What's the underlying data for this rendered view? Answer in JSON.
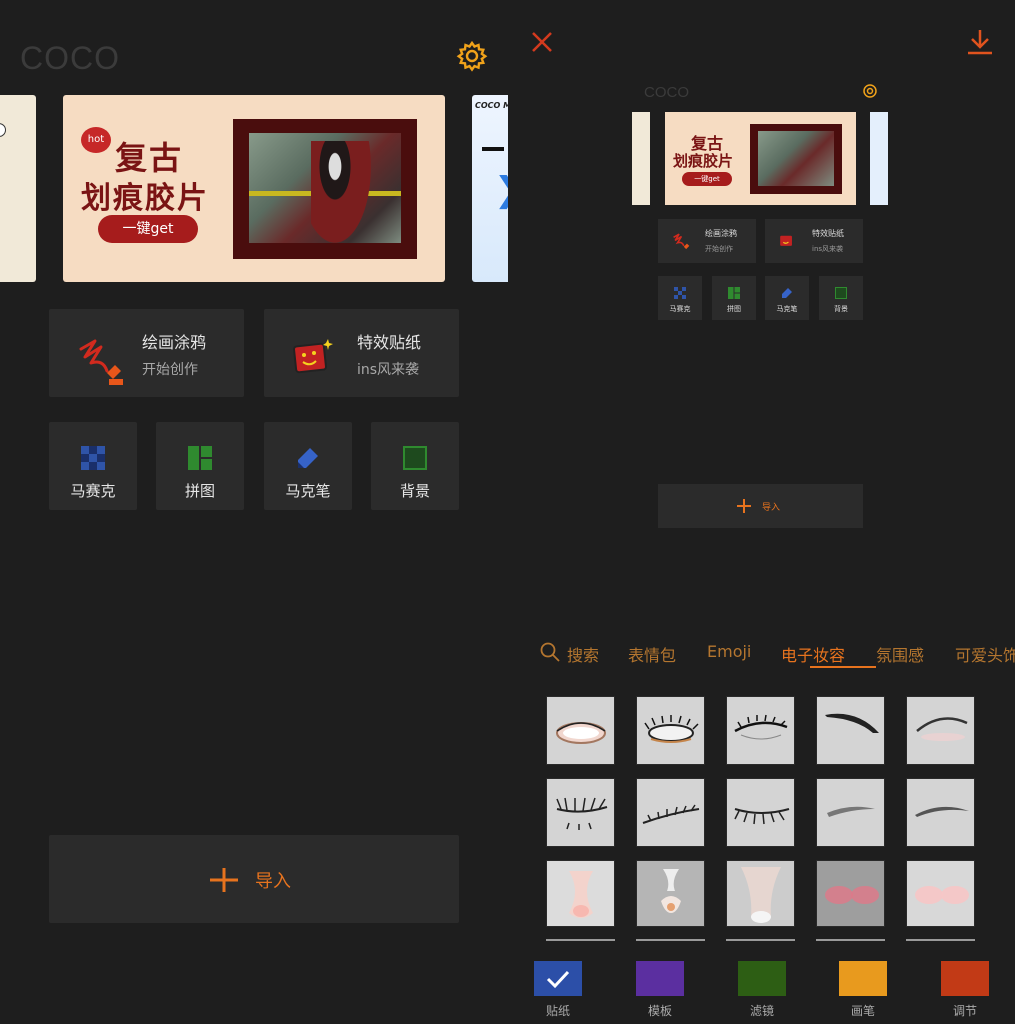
{
  "left": {
    "app_title": "COCO",
    "banner": {
      "hot": "hot",
      "title_line1": "复古",
      "title_line2": "划痕胶片",
      "cta": "一键get",
      "next_tag": "COCO MA"
    },
    "features": [
      {
        "title": "绘画涂鸦",
        "subtitle": "开始创作",
        "icon": "brush-scribble-icon"
      },
      {
        "title": "特效贴纸",
        "subtitle": "ins风来袭",
        "icon": "sticker-face-icon"
      }
    ],
    "tools": [
      {
        "label": "马赛克",
        "icon": "mosaic-icon",
        "color": "#2f54a8"
      },
      {
        "label": "拼图",
        "icon": "collage-icon",
        "color": "#2f8a2f"
      },
      {
        "label": "马克笔",
        "icon": "marker-icon",
        "color": "#3663c8"
      },
      {
        "label": "背景",
        "icon": "background-icon",
        "color": "#2f7a2f"
      }
    ],
    "import_label": "导入"
  },
  "right": {
    "mini": {
      "app_title": "COCO",
      "banner_title1": "复古",
      "banner_title2": "划痕胶片",
      "banner_cta": "一键get",
      "features": [
        {
          "title": "绘画涂鸦",
          "subtitle": "开始创作"
        },
        {
          "title": "特效贴纸",
          "subtitle": "ins风来袭"
        }
      ],
      "tools": [
        "马赛克",
        "拼图",
        "马克笔",
        "背景"
      ],
      "import_label": "导入"
    },
    "tabs": [
      "搜索",
      "表情包",
      "Emoji",
      "电子妆容",
      "氛围感",
      "可爱头饰"
    ],
    "active_tab": "电子妆容",
    "toolbar": [
      {
        "label": "贴纸",
        "color": "#2c4fa8",
        "checked": true
      },
      {
        "label": "模板",
        "color": "#5b2fa0"
      },
      {
        "label": "滤镜",
        "color": "#2d5e14"
      },
      {
        "label": "画笔",
        "color": "#e89a1e"
      },
      {
        "label": "调节",
        "color": "#c23a16"
      }
    ]
  },
  "colors": {
    "accent": "#e7731e",
    "background": "#1e1e1e",
    "card": "#2b2b2b",
    "banner_red": "#7a1414"
  }
}
